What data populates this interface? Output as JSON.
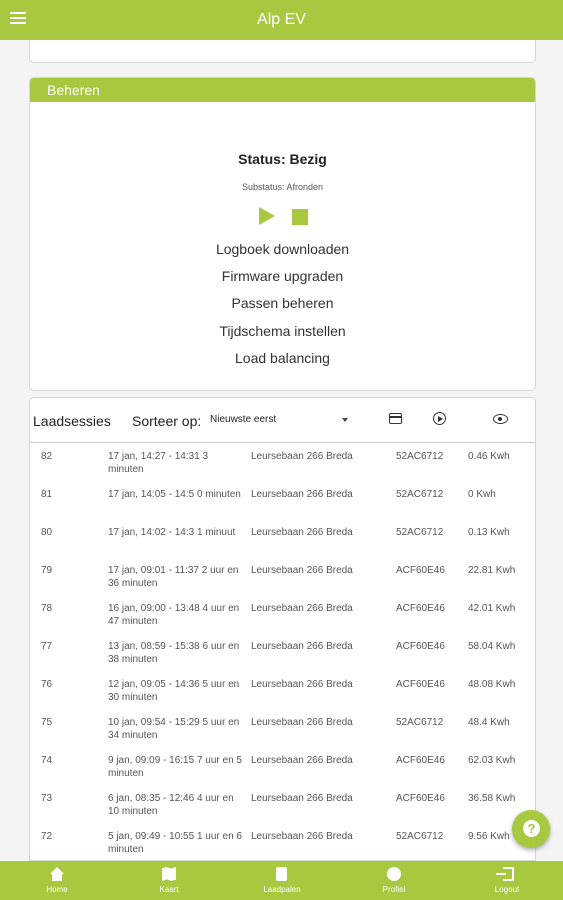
{
  "app": {
    "title": "Alp EV"
  },
  "manage": {
    "header": "Beheren",
    "status": "Status: Bezig",
    "substatus": "Substatus: Afronden",
    "actions": [
      "Logboek downloaden",
      "Firmware upgraden",
      "Passen beheren",
      "Tijdschema instellen",
      "Load balancing"
    ]
  },
  "sessions": {
    "title": "Laadsessies",
    "sort_label": "Sorteer op:",
    "sort_value": "Nieuwste eerst",
    "icons": [
      "card-icon",
      "play-circle-icon",
      "eye-icon"
    ],
    "rows": [
      {
        "id": "82",
        "time": "17 jan, 14:27 - 14:31 3 minuten",
        "location": "Leursebaan 266 Breda",
        "card": "52AC6712",
        "kwh": "0.46 Kwh"
      },
      {
        "id": "81",
        "time": "17 jan, 14:05 - 14:5 0 minuten",
        "location": "Leursebaan 266 Breda",
        "card": "52AC6712",
        "kwh": "0 Kwh"
      },
      {
        "id": "80",
        "time": "17 jan, 14:02 - 14:3 1 minuut",
        "location": "Leursebaan 266 Breda",
        "card": "52AC6712",
        "kwh": "0.13 Kwh"
      },
      {
        "id": "79",
        "time": "17 jan, 09:01 - 11:37 2 uur en 36 minuten",
        "location": "Leursebaan 266 Breda",
        "card": "ACF60E46",
        "kwh": "22.81 Kwh"
      },
      {
        "id": "78",
        "time": "16 jan, 09:00 - 13:48 4 uur en 47 minuten",
        "location": "Leursebaan 266 Breda",
        "card": "ACF60E46",
        "kwh": "42.01 Kwh"
      },
      {
        "id": "77",
        "time": "13 jan, 08:59 - 15:38 6 uur en 38 minuten",
        "location": "Leursebaan 266 Breda",
        "card": "ACF60E46",
        "kwh": "58.04 Kwh"
      },
      {
        "id": "76",
        "time": "12 jan, 09:05 - 14:36 5 uur en 30 minuten",
        "location": "Leursebaan 266 Breda",
        "card": "ACF60E46",
        "kwh": "48.08 Kwh"
      },
      {
        "id": "75",
        "time": "10 jan, 09:54 - 15:29 5 uur en 34 minuten",
        "location": "Leursebaan 266 Breda",
        "card": "52AC6712",
        "kwh": "48.4 Kwh"
      },
      {
        "id": "74",
        "time": "9 jan, 09:09 - 16:15 7 uur en 5 minuten",
        "location": "Leursebaan 266 Breda",
        "card": "ACF60E46",
        "kwh": "62.03 Kwh"
      },
      {
        "id": "73",
        "time": "6 jan, 08:35 - 12:46 4 uur en 10 minuten",
        "location": "Leursebaan 266 Breda",
        "card": "ACF60E46",
        "kwh": "36.58 Kwh"
      },
      {
        "id": "72",
        "time": "5 jan, 09:49 - 10:55 1 uur en 6 minuten",
        "location": "Leursebaan 266 Breda",
        "card": "52AC6712",
        "kwh": "9.56 Kwh"
      }
    ]
  },
  "fab": {
    "label": "?"
  },
  "nav": [
    {
      "label": "Home",
      "icon": "home-icon"
    },
    {
      "label": "Kaart",
      "icon": "map-icon"
    },
    {
      "label": "Laadpalen",
      "icon": "charger-icon"
    },
    {
      "label": "Profiel",
      "icon": "user-icon"
    },
    {
      "label": "Logout",
      "icon": "logout-icon"
    }
  ],
  "colors": {
    "accent": "#a7c83f",
    "background": "#f4f4f4"
  }
}
